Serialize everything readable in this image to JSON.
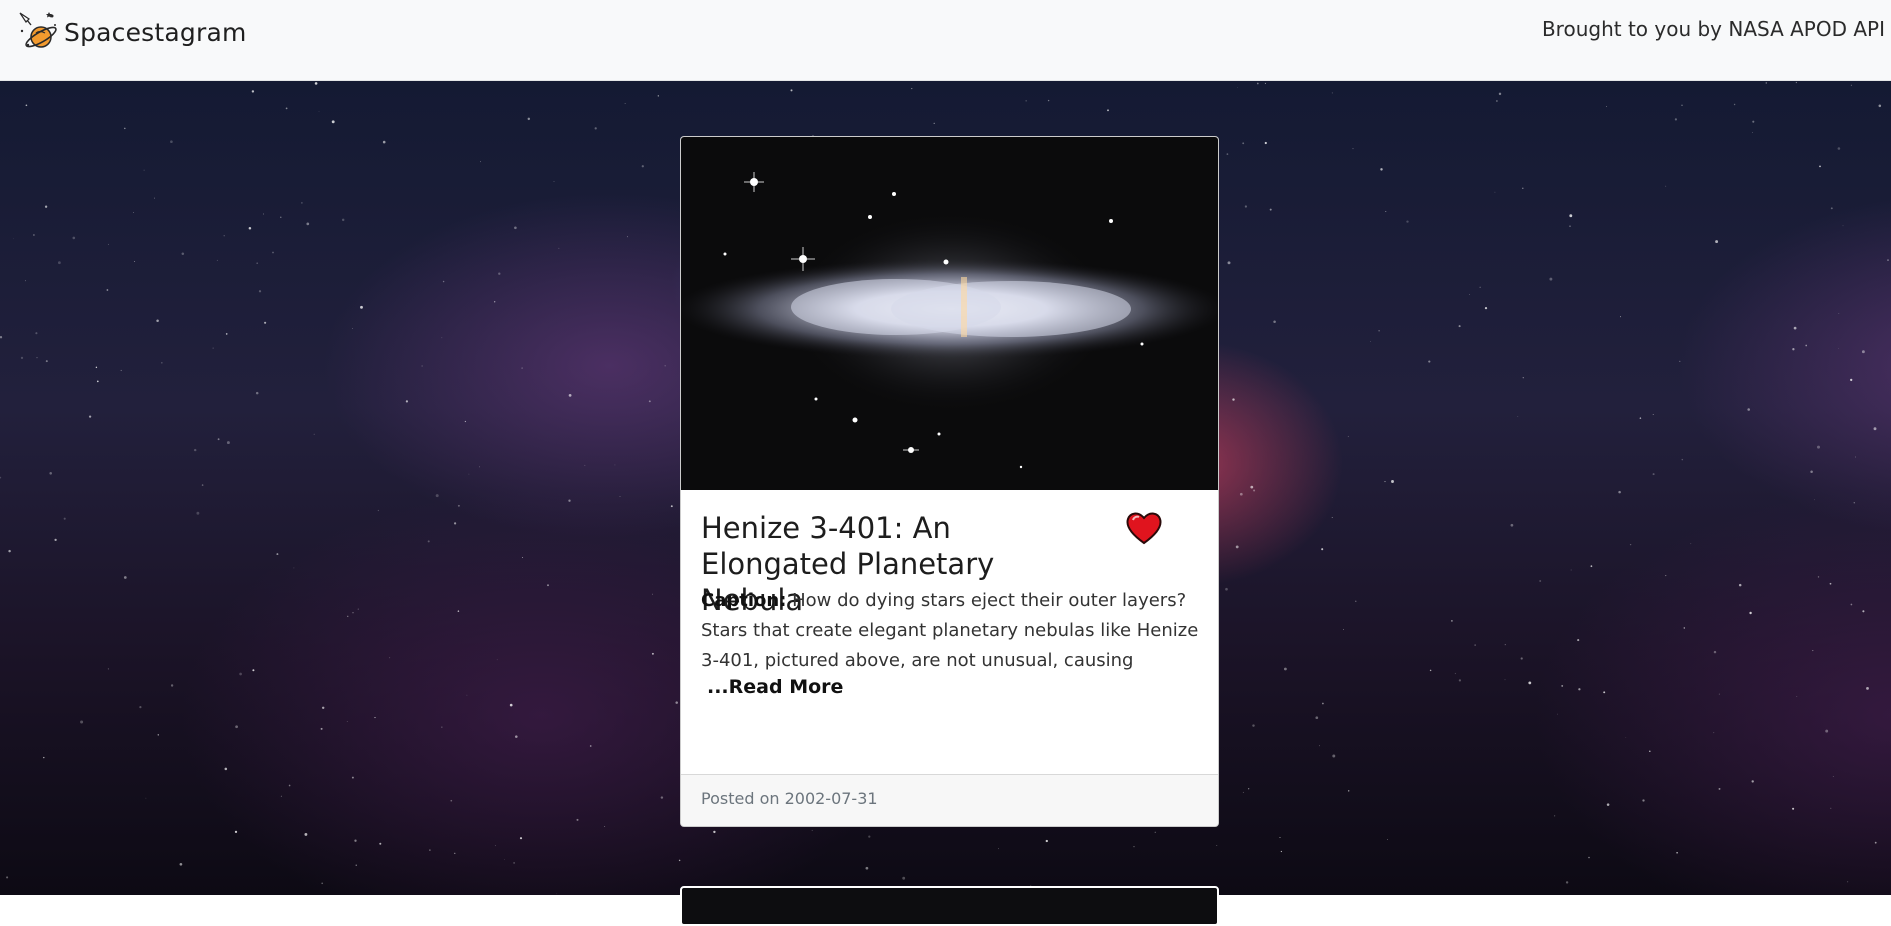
{
  "navbar": {
    "brand": "Spacestagram",
    "brand_icon": "rocket-planet-logo-icon",
    "credit": "Brought to you by NASA APOD API"
  },
  "background": {
    "icon": "galaxy-background"
  },
  "post": {
    "title": "Henize 3-401: An Elongated Planetary Nebula",
    "caption_label": "Caption:",
    "caption_text": " How do dying stars eject their outer layers? Stars that create elegant planetary nebulas like Henize 3-401, pictured above, are not unusual, causing",
    "read_more": "...Read More",
    "posted": "Posted on 2002-07-31",
    "liked": true,
    "like_icon": "heart-icon",
    "like_color": "#e0141e"
  }
}
